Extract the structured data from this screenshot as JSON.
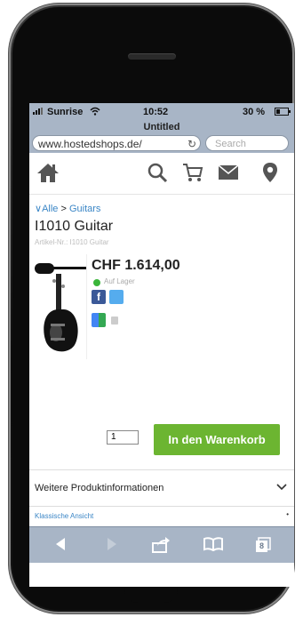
{
  "status_bar": {
    "carrier": "Sunrise",
    "time": "10:52",
    "battery": "30 %"
  },
  "browser": {
    "page_title": "Untitled",
    "url": "www.hostedshops.de/",
    "search_placeholder": "Search"
  },
  "site_nav": {
    "icons": [
      "home-icon",
      "search-icon",
      "cart-icon",
      "mail-icon",
      "location-pin-icon"
    ]
  },
  "breadcrumb": {
    "items": [
      "Alle",
      "Guitars"
    ],
    "separator": ">"
  },
  "product": {
    "title": "I1010 Guitar",
    "sku": "Artikel-Nr.: I1010 Guitar",
    "price": "CHF 1.614,00",
    "stock": "Auf Lager",
    "quantity": "1",
    "add_to_cart_label": "In den Warenkorb"
  },
  "more_info": {
    "label": "Weitere Produktinformationen"
  },
  "footer": {
    "classic_view": "Klassische Ansicht",
    "tab_count": "8"
  },
  "colors": {
    "chrome": "#a8b5c6",
    "cart_button": "#6cb531",
    "link": "#3b86c6"
  }
}
